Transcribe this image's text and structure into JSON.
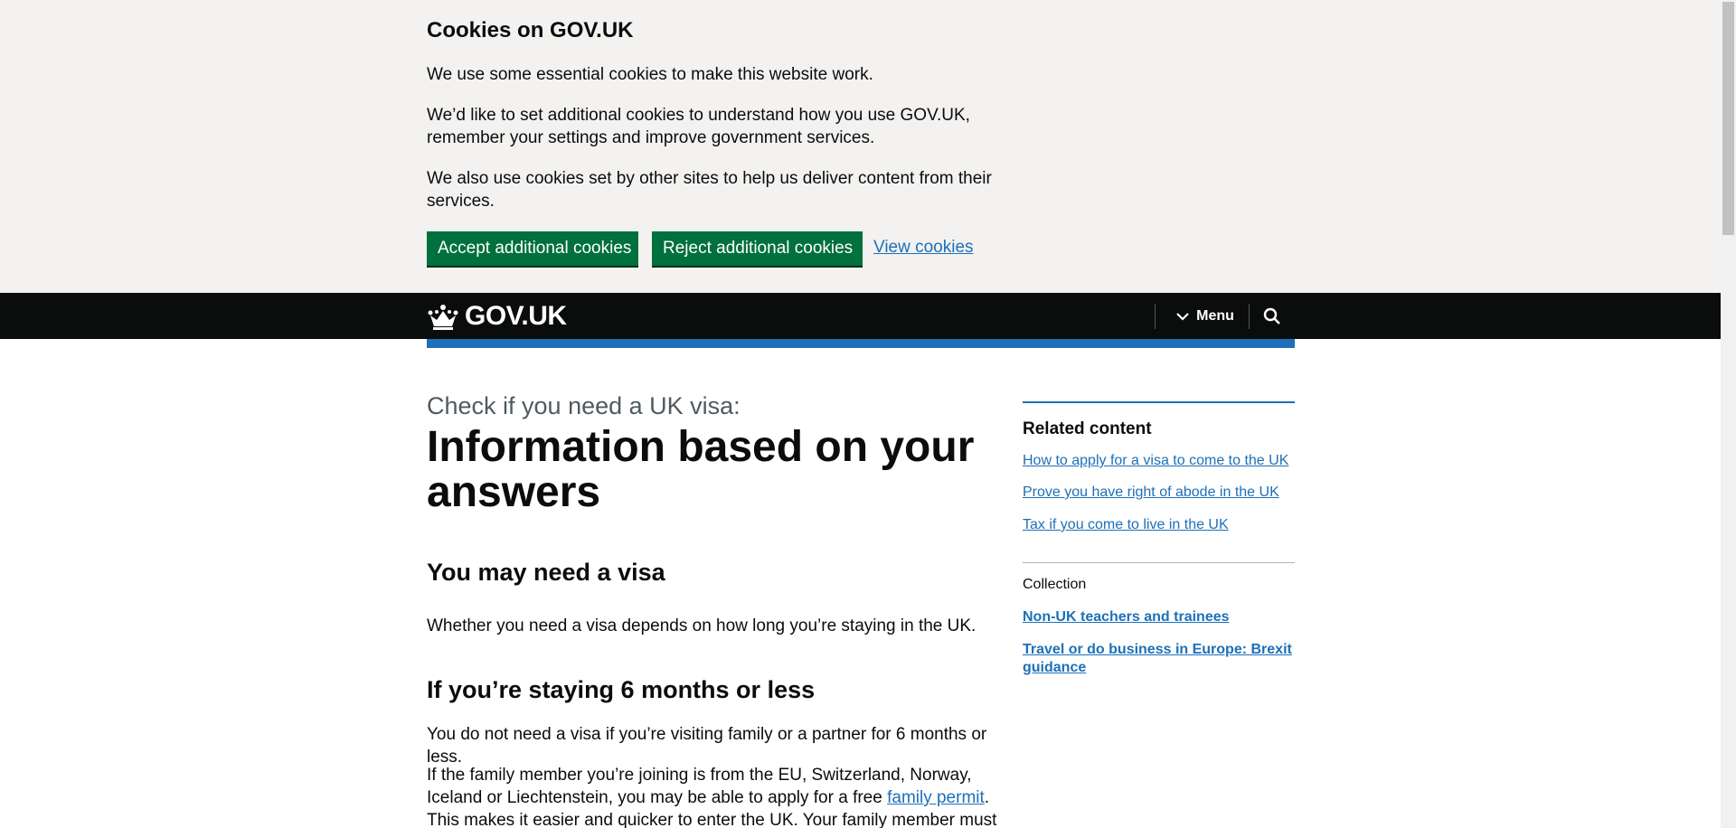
{
  "cookie_banner": {
    "title": "Cookies on GOV.UK",
    "paragraphs": [
      "We use some essential cookies to make this website work.",
      "We’d like to set additional cookies to understand how you use GOV.UK, remember your settings and improve government services.",
      "We also use cookies set by other sites to help us deliver content from their services."
    ],
    "accept_label": "Accept additional cookies",
    "reject_label": "Reject additional cookies",
    "view_label": "View cookies",
    "button_color": "#00703c"
  },
  "header": {
    "logo_text": "GOV.UK",
    "logo_icon": "crown-icon",
    "menu_label": "Menu",
    "menu_icon": "chevron-down-icon",
    "search_icon": "search-icon",
    "accent_color": "#1d70b8"
  },
  "main": {
    "caption": "Check if you need a UK visa:",
    "title": "Information based on your answers",
    "section1_heading": "You may need a visa",
    "section1_text": "Whether you need a visa depends on how long you’re staying in the UK.",
    "section2_heading": "If you’re staying 6 months or less",
    "section2_text": "You do not need a visa if you’re visiting family or a partner for 6 months or less.",
    "section2_para2_before": "If the family member you’re joining is from the EU, Switzerland, Norway, Iceland or Liechtenstein, you may be able to apply for a free ",
    "section2_para2_link": "family permit",
    "section2_para2_after": ". This makes it easier and quicker to enter the UK. Your family member must"
  },
  "sidebar": {
    "related_title": "Related content",
    "related_links": [
      "How to apply for a visa to come to the UK",
      "Prove you have right of abode in the UK",
      "Tax if you come to live in the UK"
    ],
    "collection_label": "Collection",
    "collection_links": [
      "Non-UK teachers and trainees",
      "Travel or do business in Europe: Brexit guidance"
    ]
  }
}
